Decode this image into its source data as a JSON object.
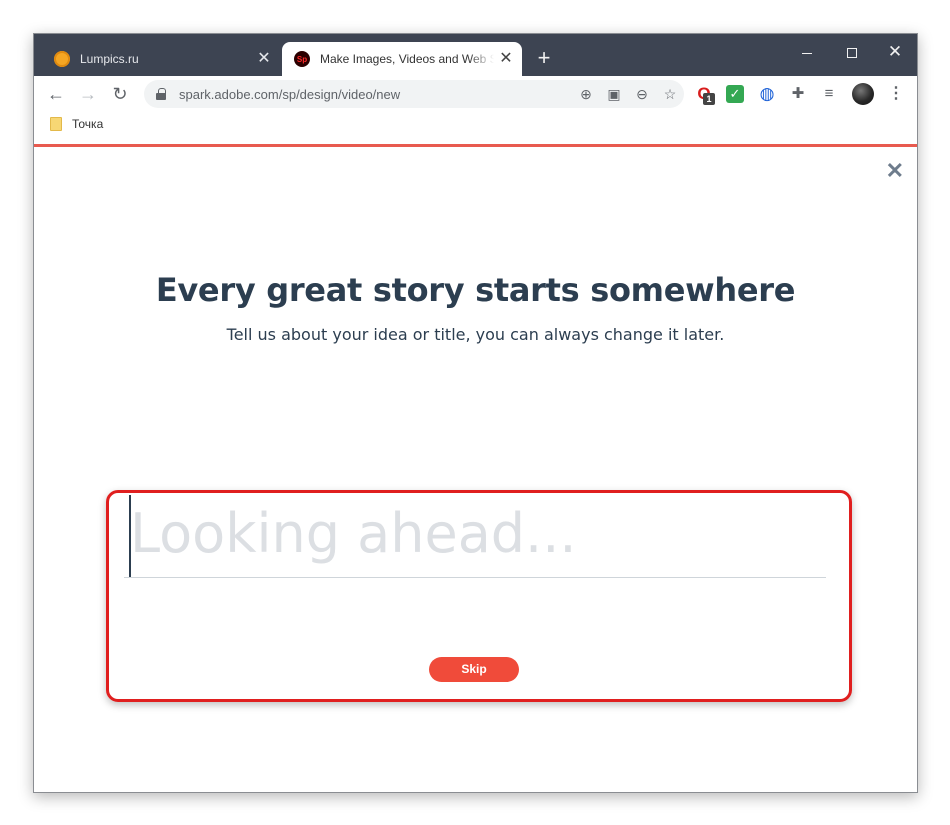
{
  "browser": {
    "tabs": [
      {
        "title": "Lumpics.ru",
        "active": false
      },
      {
        "title": "Make Images, Videos and Web S",
        "active": true,
        "favicon_text": "Sp"
      }
    ],
    "address": "spark.adobe.com/sp/design/video/new",
    "bookmarks": [
      {
        "label": "Точка"
      }
    ],
    "extension_badge": "1"
  },
  "page": {
    "headline": "Every great story starts somewhere",
    "subheadline": "Tell us about your idea or title, you can always change it later.",
    "title_input": {
      "value": "",
      "placeholder": "Looking ahead..."
    },
    "skip_label": "Skip"
  },
  "colors": {
    "titlebar": "#3d4452",
    "accent_line": "#e85a4f",
    "headline": "#2c3e50",
    "skip_button": "#f04b3a",
    "highlight": "#e01f1f"
  }
}
